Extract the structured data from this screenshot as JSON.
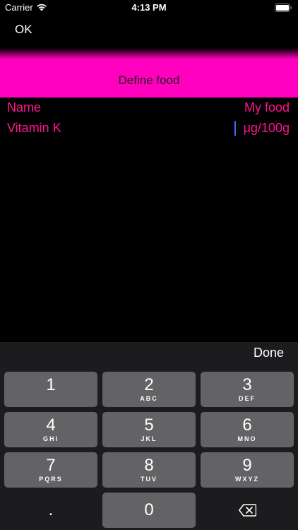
{
  "status_bar": {
    "carrier": "Carrier",
    "time": "4:13 PM",
    "wifi_icon": "wifi-icon",
    "battery_icon": "battery-icon"
  },
  "nav": {
    "ok_label": "OK"
  },
  "header": {
    "title": "Define food",
    "color": "#ff00bf"
  },
  "rows": [
    {
      "label": "Name",
      "value": "My food"
    },
    {
      "label": "Vitamin K",
      "value": "μg/100g"
    }
  ],
  "keyboard": {
    "done_label": "Done",
    "keys": [
      {
        "num": "1",
        "letters": ""
      },
      {
        "num": "2",
        "letters": "ABC"
      },
      {
        "num": "3",
        "letters": "DEF"
      },
      {
        "num": "4",
        "letters": "GHI"
      },
      {
        "num": "5",
        "letters": "JKL"
      },
      {
        "num": "6",
        "letters": "MNO"
      },
      {
        "num": "7",
        "letters": "PQRS"
      },
      {
        "num": "8",
        "letters": "TUV"
      },
      {
        "num": "9",
        "letters": "WXYZ"
      },
      {
        "num": ".",
        "letters": ""
      },
      {
        "num": "0",
        "letters": ""
      }
    ],
    "backspace_icon": "backspace-icon"
  },
  "colors": {
    "accent_text": "#ff1493",
    "cursor": "#3b6cff",
    "key_bg": "#636366",
    "keyboard_bg": "#1c1c1e"
  }
}
